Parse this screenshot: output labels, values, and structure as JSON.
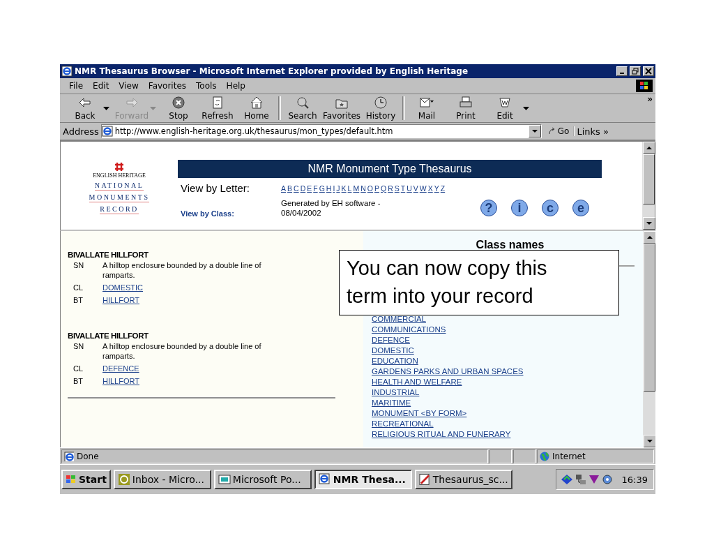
{
  "window": {
    "title": "NMR Thesaurus Browser - Microsoft Internet Explorer provided by English Heritage"
  },
  "menu": [
    "File",
    "Edit",
    "View",
    "Favorites",
    "Tools",
    "Help"
  ],
  "toolbar": [
    {
      "label": "Back",
      "kind": "back",
      "disabled": false,
      "dropdown": true,
      "group_end": false
    },
    {
      "label": "Forward",
      "kind": "forward",
      "disabled": true,
      "dropdown": true,
      "group_end": false
    },
    {
      "label": "Stop",
      "kind": "stop",
      "disabled": false,
      "dropdown": false,
      "group_end": false
    },
    {
      "label": "Refresh",
      "kind": "refresh",
      "disabled": false,
      "dropdown": false,
      "group_end": false
    },
    {
      "label": "Home",
      "kind": "home",
      "disabled": false,
      "dropdown": false,
      "group_end": true
    },
    {
      "label": "Search",
      "kind": "search",
      "disabled": false,
      "dropdown": false,
      "group_end": false
    },
    {
      "label": "Favorites",
      "kind": "favorites",
      "disabled": false,
      "dropdown": false,
      "group_end": false
    },
    {
      "label": "History",
      "kind": "history",
      "disabled": false,
      "dropdown": false,
      "group_end": true
    },
    {
      "label": "Mail",
      "kind": "mail",
      "disabled": false,
      "dropdown": false,
      "group_end": false
    },
    {
      "label": "Print",
      "kind": "print",
      "disabled": false,
      "dropdown": false,
      "group_end": false
    },
    {
      "label": "Edit",
      "kind": "edit",
      "disabled": false,
      "dropdown": true,
      "group_end": false
    }
  ],
  "toolbar_more": "»",
  "address": {
    "label": "Address",
    "value": "http://www.english-heritage.org.uk/thesaurus/mon_types/default.htm",
    "go": "Go",
    "links": "Links",
    "links_more": "»"
  },
  "header": {
    "logo": {
      "org": "ENGLISH HERITAGE",
      "lines": [
        "NATIONAL",
        "MONUMENTS",
        "RECORD"
      ]
    },
    "banner": "NMR Monument Type Thesaurus",
    "view_by_letter": "View by Letter:",
    "letters": [
      "A",
      "B",
      "C",
      "D",
      "E",
      "F",
      "G",
      "H",
      "I",
      "J",
      "K",
      "L",
      "M",
      "N",
      "O",
      "P",
      "Q",
      "R",
      "S",
      "T",
      "U",
      "V",
      "W",
      "X",
      "Y",
      "Z"
    ],
    "view_by_class": "View by Class:",
    "generated": "Generated by EH software - 08/04/2002",
    "help_buttons": [
      "?",
      "i",
      "c",
      "e"
    ]
  },
  "entries": [
    {
      "term": "BIVALLATE HILLFORT",
      "fields": [
        {
          "code": "SN",
          "text": "A hilltop enclosure bounded by a double line of ramparts.",
          "link": false
        },
        {
          "code": "CL",
          "text": "DOMESTIC",
          "link": true
        },
        {
          "code": "BT",
          "text": "HILLFORT",
          "link": true
        }
      ]
    },
    {
      "term": "BIVALLATE HILLFORT",
      "fields": [
        {
          "code": "SN",
          "text": "A hilltop enclosure bounded by a double line of ramparts.",
          "link": false
        },
        {
          "code": "CL",
          "text": "DEFENCE",
          "link": true
        },
        {
          "code": "BT",
          "text": "HILLFORT",
          "link": true
        }
      ]
    }
  ],
  "classes": {
    "heading": "Class names",
    "items": [
      "COMMERCIAL",
      "COMMUNICATIONS",
      "DEFENCE",
      "DOMESTIC",
      "EDUCATION",
      "GARDENS PARKS AND URBAN SPACES",
      "HEALTH AND WELFARE",
      "INDUSTRIAL",
      "MARITIME",
      "MONUMENT <BY FORM>",
      "RECREATIONAL",
      "RELIGIOUS RITUAL AND FUNERARY"
    ]
  },
  "callout": {
    "text": "You can now copy this term into your record"
  },
  "status_bar": {
    "text": "Done",
    "zone": "Internet"
  },
  "taskbar": {
    "start": "Start",
    "tasks": [
      {
        "label": "Inbox - Micro...",
        "kind": "mail",
        "selected": false
      },
      {
        "label": "Microsoft Po...",
        "kind": "slides",
        "selected": false
      },
      {
        "label": "NMR Thesa...",
        "kind": "browser",
        "selected": true
      },
      {
        "label": "Thesaurus_sc...",
        "kind": "paint",
        "selected": false
      }
    ],
    "clock": "16:39"
  }
}
